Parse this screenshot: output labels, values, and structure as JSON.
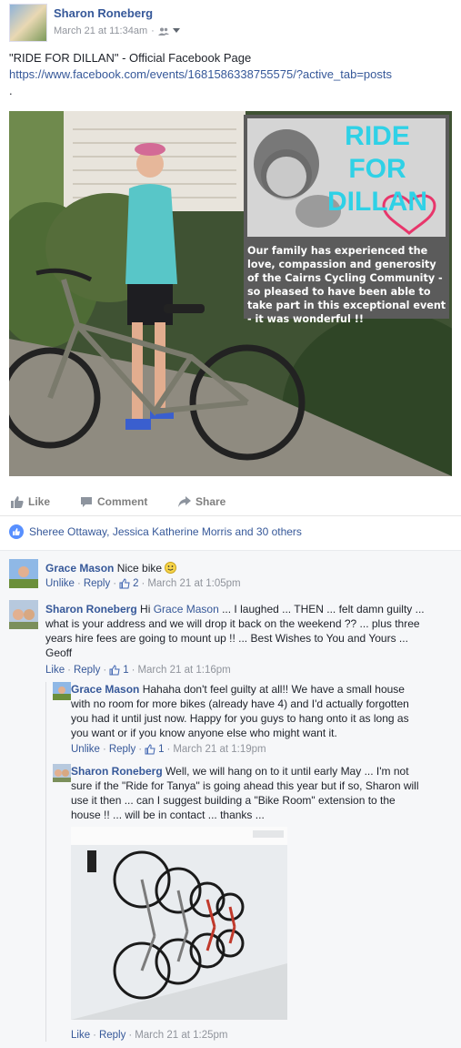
{
  "post": {
    "author": "Sharon Roneberg",
    "timestamp": "March 21 at 11:34am",
    "separator": "·",
    "text": "\"RIDE FOR DILLAN\" - Official Facebook Page",
    "url": "https://www.facebook.com/events/1681586338755575/?active_tab=posts",
    "dot": ".",
    "photo": {
      "overlay_title": [
        "RIDE",
        "FOR",
        "DILLAN"
      ],
      "overlay_caption": "Our family has experienced the love, compassion and generosity of the Cairns Cycling Community - so pleased to have been able to take part in this exceptional event - it was wonderful !!"
    }
  },
  "actions": {
    "like": "Like",
    "comment": "Comment",
    "share": "Share"
  },
  "likes_summary": "Sheree Ottaway, Jessica Katherine Morris and 30 others",
  "comments": [
    {
      "name": "Grace Mason",
      "text": "Nice bike",
      "like": "Unlike",
      "reply": "Reply",
      "count": "2",
      "time": "March 21 at 1:05pm"
    },
    {
      "name": "Sharon Roneberg",
      "text_prefix": "Hi",
      "mention": "Grace Mason",
      "text": "... I laughed ... THEN ... felt damn guilty ... what is your address and we will drop it back on the weekend ?? ... plus three years hire fees are going to mount up !! ... Best Wishes to You and Yours ... Geoff",
      "like": "Like",
      "reply": "Reply",
      "count": "1",
      "time": "March 21 at 1:16pm"
    },
    {
      "name": "Grace Mason",
      "text": "Hahaha don't feel guilty at all!! We have a small house with no room for more bikes (already have 4) and I'd actually forgotten you had it until just now. Happy for you guys to hang onto it as long as you want or if you know anyone else who might want it.",
      "like": "Unlike",
      "reply": "Reply",
      "count": "1",
      "time": "March 21 at 1:19pm"
    },
    {
      "name": "Sharon Roneberg",
      "text": "Well, we will hang on to it until early May ... I'm not sure if the \"Ride for Tanya\" is going ahead this year but if so, Sharon will use it then ... can I suggest building a \"Bike Room\" extension to the house !! ... will be in contact ... thanks ...",
      "like": "Like",
      "reply": "Reply",
      "time": "March 21 at 1:25pm"
    }
  ]
}
